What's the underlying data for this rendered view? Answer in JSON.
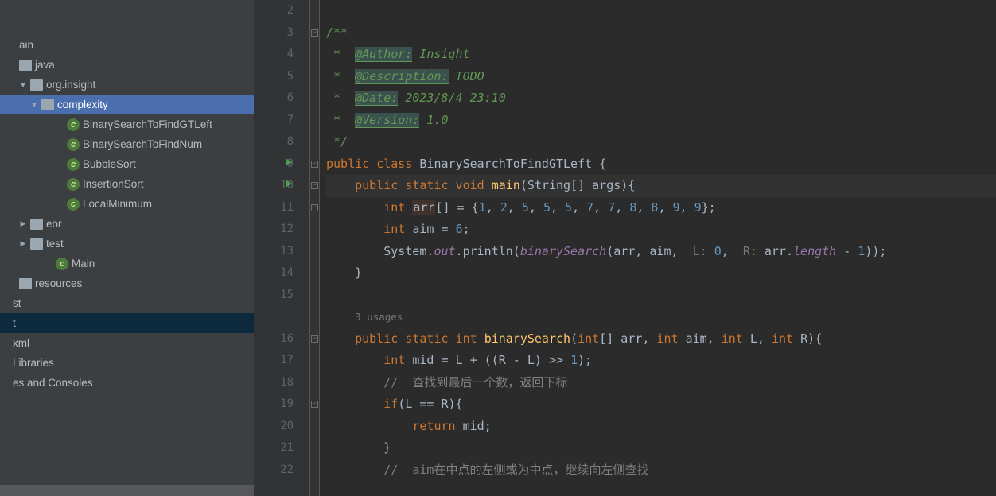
{
  "sidebar": {
    "items": [
      {
        "indent": 8,
        "chev": "",
        "icon": "",
        "label": "ain"
      },
      {
        "indent": 8,
        "chev": "",
        "icon": "folder",
        "label": "java"
      },
      {
        "indent": 22,
        "chev": "down",
        "icon": "folder",
        "label": "org.insight"
      },
      {
        "indent": 36,
        "chev": "down",
        "icon": "folder",
        "label": "complexity",
        "selected": true
      },
      {
        "indent": 68,
        "chev": "",
        "icon": "class",
        "label": "BinarySearchToFindGTLeft"
      },
      {
        "indent": 68,
        "chev": "",
        "icon": "class",
        "label": "BinarySearchToFindNum"
      },
      {
        "indent": 68,
        "chev": "",
        "icon": "class",
        "label": "BubbleSort"
      },
      {
        "indent": 68,
        "chev": "",
        "icon": "class",
        "label": "InsertionSort"
      },
      {
        "indent": 68,
        "chev": "",
        "icon": "class",
        "label": "LocalMinimum"
      },
      {
        "indent": 22,
        "chev": "right",
        "icon": "folder",
        "label": "eor"
      },
      {
        "indent": 22,
        "chev": "right",
        "icon": "folder",
        "label": "test"
      },
      {
        "indent": 54,
        "chev": "",
        "icon": "class",
        "label": "Main"
      },
      {
        "indent": 8,
        "chev": "",
        "icon": "folder",
        "label": "resources"
      },
      {
        "indent": 0,
        "chev": "",
        "icon": "",
        "label": "st"
      },
      {
        "indent": 0,
        "chev": "",
        "icon": "",
        "label": "t",
        "dim": true
      },
      {
        "indent": 0,
        "chev": "",
        "icon": "",
        "label": "xml"
      },
      {
        "indent": 0,
        "chev": "",
        "icon": "",
        "label": " Libraries"
      },
      {
        "indent": 0,
        "chev": "",
        "icon": "",
        "label": "es and Consoles"
      }
    ]
  },
  "gutter": {
    "start": 2,
    "lines": [
      2,
      3,
      4,
      5,
      6,
      7,
      8,
      9,
      10,
      11,
      12,
      13,
      14,
      15,
      "",
      16,
      17,
      18,
      19,
      20,
      21,
      22
    ],
    "runnable": [
      9,
      10
    ]
  },
  "code": {
    "doc": {
      "open": "/**",
      "author_tag": "@Author:",
      "author_val": " Insight",
      "desc_tag": "@Description:",
      "desc_val": " TODO",
      "date_tag": "@Date:",
      "date_val": " 2023/8/4 23:10",
      "ver_tag": "@Version:",
      "ver_val": " 1.0",
      "close": "*/"
    },
    "class_name": "BinarySearchToFindGTLeft",
    "main_sig": {
      "kw1": "public",
      "kw2": "static",
      "kw3": "void",
      "name": "main",
      "params": "(String[] args){"
    },
    "arr_decl": {
      "type": "int",
      "name": "arr",
      "vals": [
        "1",
        "2",
        "5",
        "5",
        "5",
        "7",
        "7",
        "8",
        "8",
        "9",
        "9"
      ]
    },
    "aim_decl": {
      "type": "int",
      "name": "aim",
      "val": "6"
    },
    "println": {
      "obj": "System",
      "field": "out",
      "m": "println",
      "fn": "binarySearch",
      "hintL": "L:",
      "valL": "0",
      "hintR": "R:",
      "arr": "arr",
      "len": "length",
      "minus": "1"
    },
    "usages": "3 usages",
    "bs_sig": {
      "kw1": "public",
      "kw2": "static",
      "kw3": "int",
      "name": "binarySearch",
      "p1t": "int",
      "p1n": "[] arr",
      "p2t": "int",
      "p2n": "aim",
      "p3t": "int",
      "p3n": "L",
      "p4t": "int",
      "p4n": "R"
    },
    "mid": {
      "type": "int",
      "expr": "mid = L + ((R - L) >> 1);",
      "one": "1"
    },
    "c1": "//  查找到最后一个数，返回下标",
    "if1": "if(L == R){",
    "ret": "return",
    "retv": "mid",
    "c2": "//  aim在中点的左侧或为中点，继续向左侧查找"
  }
}
